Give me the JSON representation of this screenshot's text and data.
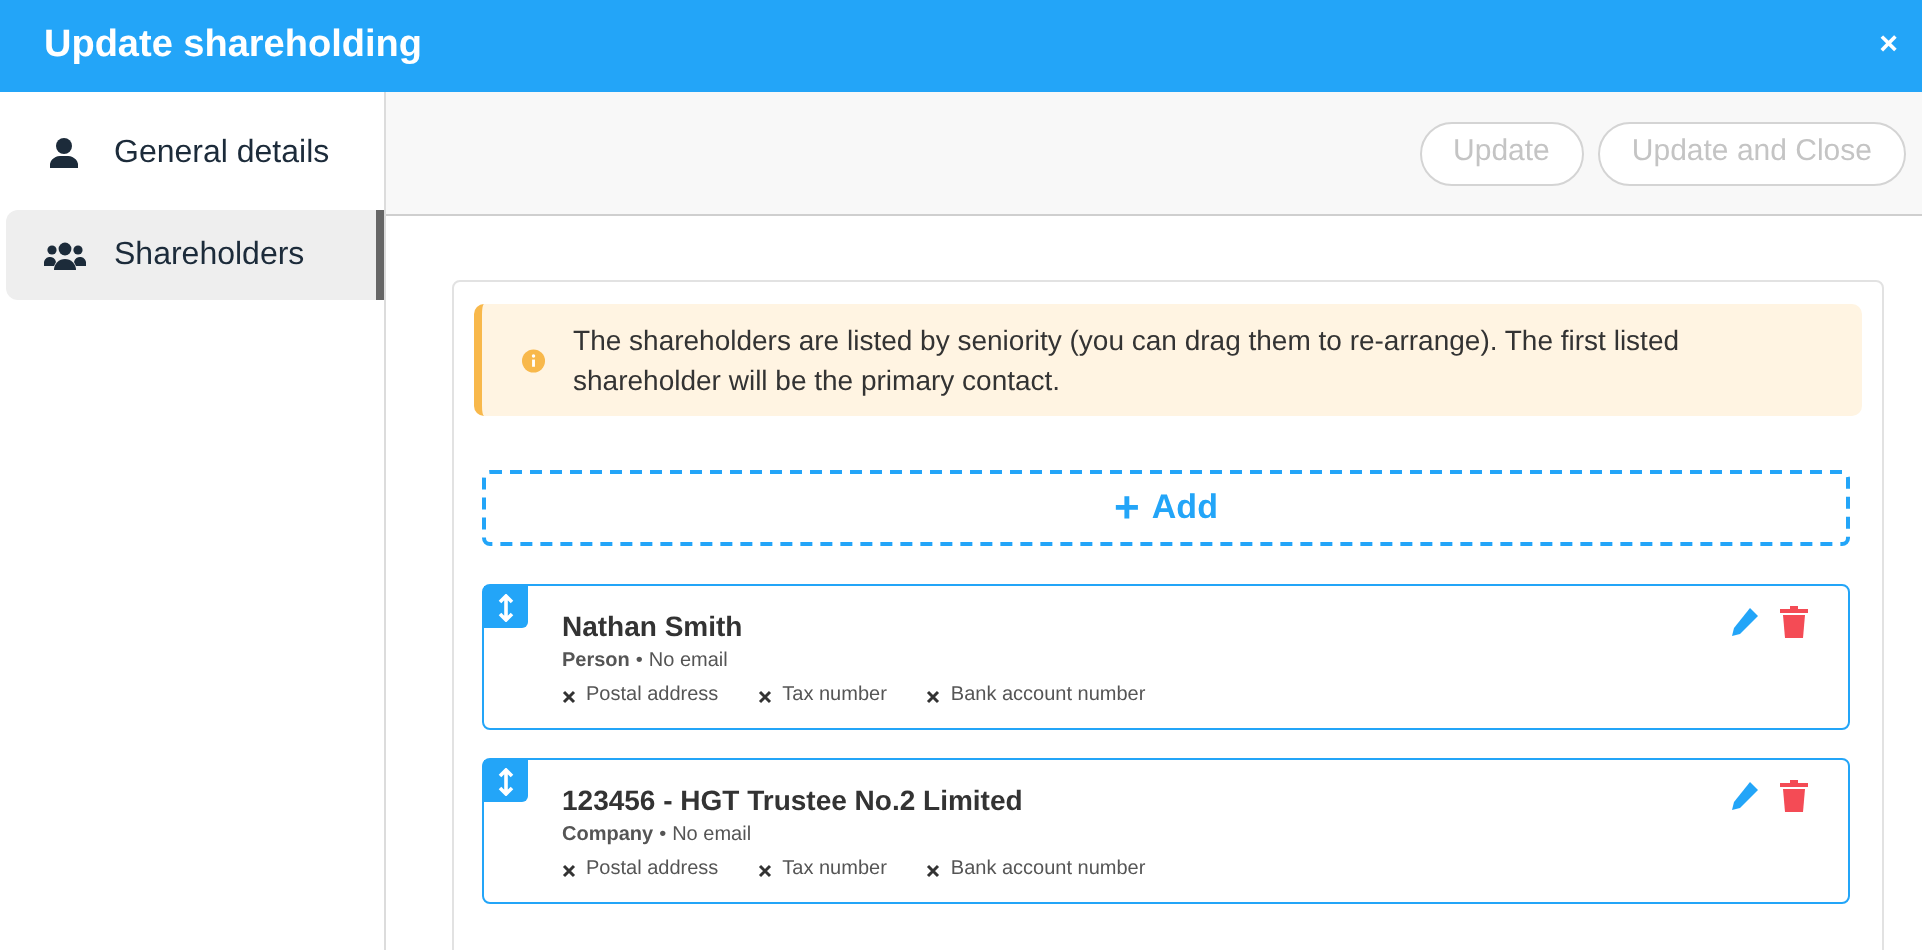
{
  "window": {
    "title": "Update shareholding",
    "close": "×"
  },
  "sidebar": {
    "items": [
      {
        "label": "General details",
        "kind": "person",
        "selected": false
      },
      {
        "label": "Shareholders",
        "kind": "people",
        "selected": true
      }
    ]
  },
  "toolbar": {
    "buttons": [
      {
        "label": "Update",
        "disabled": true
      },
      {
        "label": "Update and Close",
        "disabled": true
      }
    ]
  },
  "alert": {
    "text": "The shareholders are listed by seniority (you can drag them to re-arrange). The first listed shareholder will be the primary contact."
  },
  "add_button": {
    "icon": "+",
    "label": "Add"
  },
  "shareholders": [
    {
      "name": "Nathan Smith",
      "type": "Person",
      "separator": "•",
      "email": "No email",
      "details": [
        {
          "label": "Postal address",
          "present": false
        },
        {
          "label": "Tax number",
          "present": false
        },
        {
          "label": "Bank account number",
          "present": false
        }
      ]
    },
    {
      "name": "123456 - HGT Trustee No.2 Limited",
      "type": "Company",
      "separator": "•",
      "email": "No email",
      "details": [
        {
          "label": "Postal address",
          "present": false
        },
        {
          "label": "Tax number",
          "present": false
        },
        {
          "label": "Bank account number",
          "present": false
        }
      ]
    }
  ]
}
